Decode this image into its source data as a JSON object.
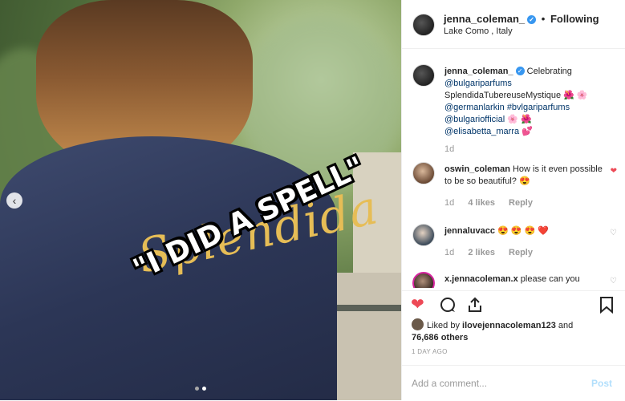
{
  "photo": {
    "robe_text": "Splendida",
    "caption": "\"I DID A SPELL\"",
    "prev_icon": "chevron-left-icon",
    "carousel": {
      "count": 2,
      "active": 1
    }
  },
  "header": {
    "username": "jenna_coleman_",
    "separator": "•",
    "follow_status": "Following",
    "location": "Lake Como , Italy"
  },
  "caption_post": {
    "username": "jenna_coleman_",
    "text_plain": "Celebrating",
    "mention_bulgari": "@bulgariparfums",
    "line2": "SplendidaTubereuseMystique 🌺 🌸",
    "mention_german": "@germanlarkin",
    "hashtag": "#bvlgariparfums",
    "mention_official": "@bulgariofficial",
    "line4_emoji": "🌸 🌺",
    "mention_elisabetta": "@elisabetta_marra",
    "line5_emoji": "💕",
    "age": "1d"
  },
  "comments": [
    {
      "username": "oswin_coleman",
      "text": "How is it even possible to be so beautiful? 😍",
      "age": "1d",
      "likes": "4 likes",
      "reply": "Reply",
      "liked": true
    },
    {
      "username": "jennaluvacc",
      "text": "😍 😍 😍 ❤️",
      "age": "1d",
      "likes": "2 likes",
      "reply": "Reply",
      "liked": false
    },
    {
      "username": "x.jennacoleman.x",
      "text": "please can you",
      "liked": false
    }
  ],
  "actions": {
    "like_icon": "heart-filled-icon",
    "comment_icon": "comment-icon",
    "share_icon": "share-icon",
    "save_icon": "bookmark-icon"
  },
  "likes": {
    "prefix": "Liked by",
    "user": "ilovejennacoleman123",
    "and": "and",
    "others": "76,686 others"
  },
  "timestamp": "1 DAY AGO",
  "add_comment": {
    "placeholder": "Add a comment...",
    "post_label": "Post"
  },
  "colors": {
    "link": "#003569",
    "verified": "#3897f0",
    "heart": "#ed4956",
    "post": "#b2dffc"
  }
}
